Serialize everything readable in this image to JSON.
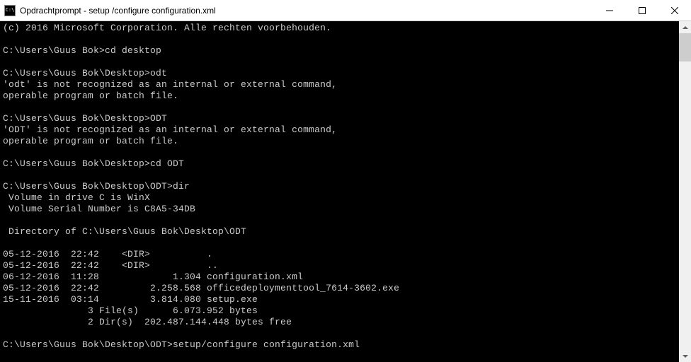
{
  "titlebar": {
    "icon_text": "C:\\",
    "title": "Opdrachtprompt - setup /configure configuration.xml"
  },
  "console": {
    "lines": [
      "(c) 2016 Microsoft Corporation. Alle rechten voorbehouden.",
      "",
      "C:\\Users\\Guus Bok>cd desktop",
      "",
      "C:\\Users\\Guus Bok\\Desktop>odt",
      "'odt' is not recognized as an internal or external command,",
      "operable program or batch file.",
      "",
      "C:\\Users\\Guus Bok\\Desktop>ODT",
      "'ODT' is not recognized as an internal or external command,",
      "operable program or batch file.",
      "",
      "C:\\Users\\Guus Bok\\Desktop>cd ODT",
      "",
      "C:\\Users\\Guus Bok\\Desktop\\ODT>dir",
      " Volume in drive C is WinX",
      " Volume Serial Number is C8A5-34DB",
      "",
      " Directory of C:\\Users\\Guus Bok\\Desktop\\ODT",
      "",
      "05-12-2016  22:42    <DIR>          .",
      "05-12-2016  22:42    <DIR>          ..",
      "06-12-2016  11:28             1.304 configuration.xml",
      "05-12-2016  22:42         2.258.568 officedeploymenttool_7614-3602.exe",
      "15-11-2016  03:14         3.814.080 setup.exe",
      "               3 File(s)      6.073.952 bytes",
      "               2 Dir(s)  202.487.144.448 bytes free",
      "",
      "C:\\Users\\Guus Bok\\Desktop\\ODT>setup/configure configuration.xml"
    ]
  }
}
